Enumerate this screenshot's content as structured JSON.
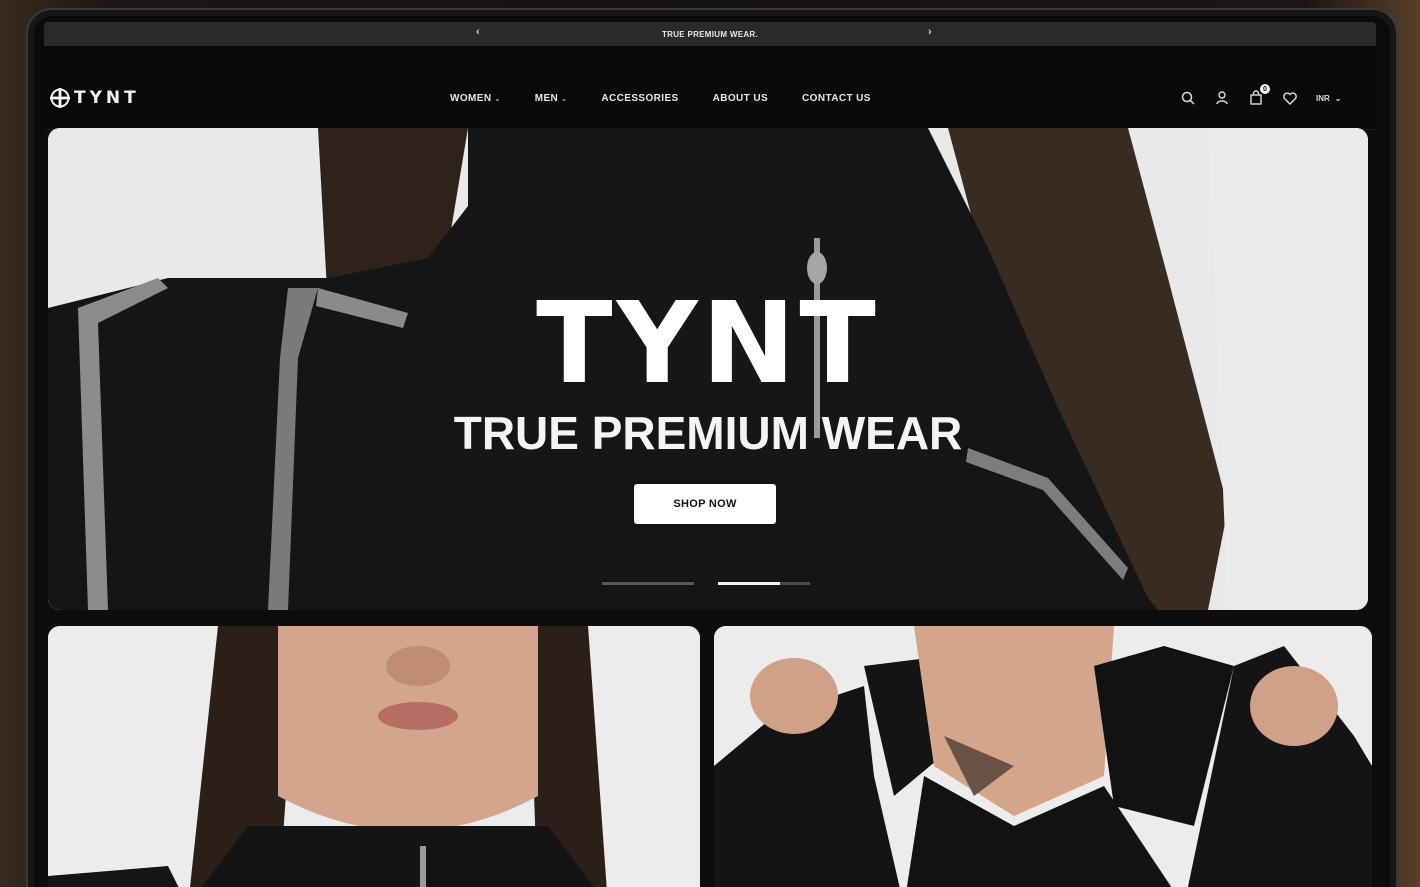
{
  "announcement": {
    "text": "TRUE PREMIUM WEAR.",
    "prev_arrow": "‹",
    "next_arrow": "›"
  },
  "brand": {
    "name": "TYNT",
    "logo_icon": "cross-circle-logo"
  },
  "nav": {
    "items": [
      {
        "label": "WOMEN",
        "has_dropdown": true
      },
      {
        "label": "MEN",
        "has_dropdown": true
      },
      {
        "label": "ACCESSORIES",
        "has_dropdown": false
      },
      {
        "label": "ABOUT US",
        "has_dropdown": false
      },
      {
        "label": "CONTACT US",
        "has_dropdown": false
      }
    ],
    "dropdown_glyph": "⌄"
  },
  "header_icons": {
    "search": "search-icon",
    "account": "user-icon",
    "cart": "bag-icon",
    "cart_count": "0",
    "wishlist": "heart-icon",
    "language": "INR"
  },
  "hero": {
    "title": "TYNT",
    "subtitle": "TRUE PREMIUM WEAR",
    "cta": "SHOP NOW",
    "slide_count": 2,
    "active_slide": 2
  },
  "tiles": [
    {
      "name": "women-collection-tile"
    },
    {
      "name": "men-collection-tile"
    }
  ],
  "colors": {
    "background": "#0d0d0d",
    "hero_bg": "#e8e8e8",
    "garment": "#141414",
    "accent_white": "#ffffff"
  }
}
